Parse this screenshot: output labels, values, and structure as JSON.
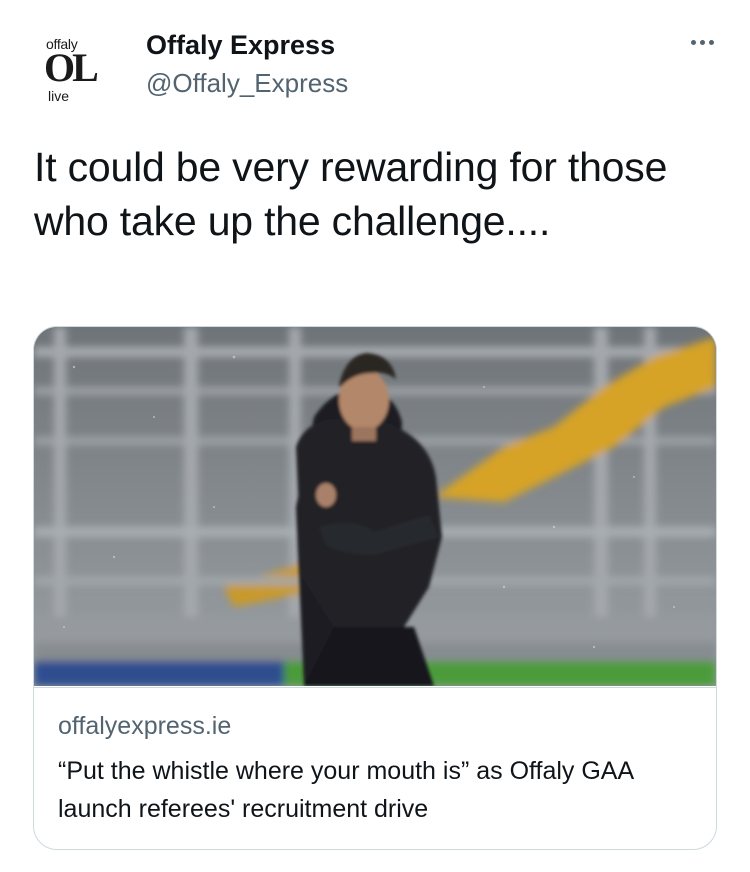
{
  "account": {
    "name": "Offaly Express",
    "handle": "@Offaly_Express",
    "avatar_logo": {
      "top_text": "offaly",
      "mark_text": "OL",
      "bottom_text": "live"
    }
  },
  "more_menu": {
    "icon": "more-horizontal-icon"
  },
  "tweet": {
    "text": "It could be very rewarding for those who take up the challenge...."
  },
  "card": {
    "image_alt": "referee-photo",
    "domain": "offalyexpress.ie",
    "title": "“Put the whistle where your mouth is” as Offaly GAA launch referees' recruitment drive"
  },
  "colors": {
    "text_primary": "#0f1419",
    "text_secondary": "#536471",
    "border": "#cfd9de",
    "stand_seats": "#d6a328",
    "pitch_green": "#4c9b3b",
    "ad_blue": "#2f4d8f"
  }
}
